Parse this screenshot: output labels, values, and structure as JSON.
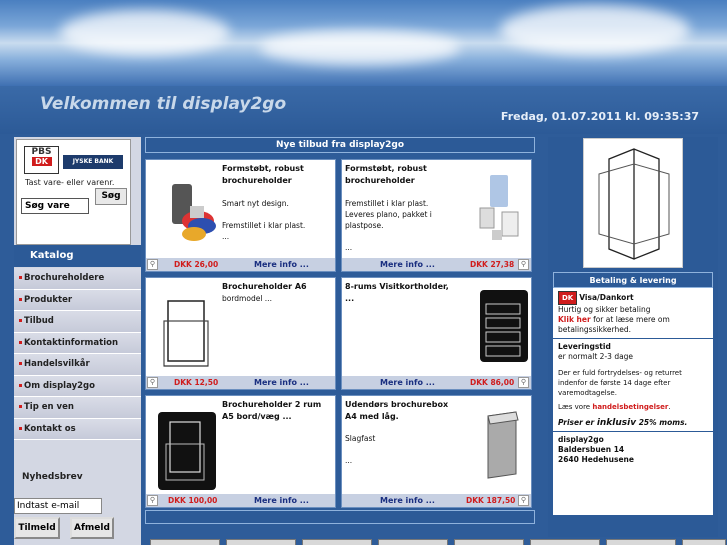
{
  "header": {
    "welcome": "Velkommen til display2go",
    "date": "Fredag, 01.07.2011   kl. 09:35:37"
  },
  "left": {
    "pbs_text": "PBS",
    "dk_text": "DK",
    "bank_text": "JYSKE BANK",
    "search_label": "Tast vare- eller varenr.",
    "search_button": "Søg",
    "search_value": "Søg vare",
    "katalog": "Katalog",
    "menu": [
      "Brochureholdere",
      "Produkter",
      "Tilbud",
      "Kontaktinformation",
      "Handelsvilkår",
      "Om display2go",
      "Tip en ven",
      "Kontakt os"
    ],
    "newsletter_label": "Nyhedsbrev",
    "newsletter_placeholder": "Indtast e-mail",
    "subscribe": "Tilmeld",
    "unsubscribe": "Afmeld"
  },
  "center": {
    "header": "Nye tilbud fra display2go",
    "products": [
      {
        "title": "Formstøbt, robust brochureholder",
        "desc": [
          "Smart nyt design.",
          "",
          "Fremstillet i klar plast.",
          "..."
        ],
        "price": "DKK 26,00",
        "more": "Mere info ..."
      },
      {
        "title": "Formstøbt, robust brochureholder",
        "desc": [
          "Fremstillet i klar plast.",
          "Leveres plano, pakket i plastpose.",
          "",
          "..."
        ],
        "price": "DKK 27,38",
        "more": "Mere info ..."
      },
      {
        "title": "Brochureholder A6",
        "desc": [
          "bordmodel ..."
        ],
        "price": "DKK 12,50",
        "more": "Mere info ..."
      },
      {
        "title": "8-rums Visitkortholder, ...",
        "desc": [],
        "price": "DKK 86,00",
        "more": "Mere info ..."
      },
      {
        "title": "Brochureholder 2 rum A5 bord/væg ...",
        "desc": [],
        "price": "DKK 100,00",
        "more": "Mere info ..."
      },
      {
        "title": "Udendørs brochurebox A4 med låg.",
        "desc": [
          "",
          "Slagfast",
          "",
          "..."
        ],
        "price": "DKK 187,50",
        "more": "Mere info ..."
      }
    ]
  },
  "right": {
    "info_header": "Betaling & levering",
    "visa_title": "Visa/Dankort",
    "visa_line1": "Hurtig og sikker betaling",
    "klik_her": "Klik her",
    "visa_line2": "for at læse mere om betalingssikkerhed.",
    "lev_title": "Leveringstid",
    "lev_text": "er normalt 2-3 dage",
    "fortryd": "Der er fuld fortrydelses- og returret indenfor de første 14 dage efter varemodtagelse.",
    "laes_vore": "Læs vore",
    "handels": "handelsbetingelser",
    "priser_pre": "Priser er",
    "priser_inkl": "inklusiv",
    "priser_post": "25% moms.",
    "company": "display2go",
    "street": "Baldersbuen 14",
    "city": "2640 Hedehusene"
  },
  "colors": {
    "primary": "#2c5a97",
    "accent_red": "#d01c1c",
    "link_blue": "#1a2f80"
  }
}
